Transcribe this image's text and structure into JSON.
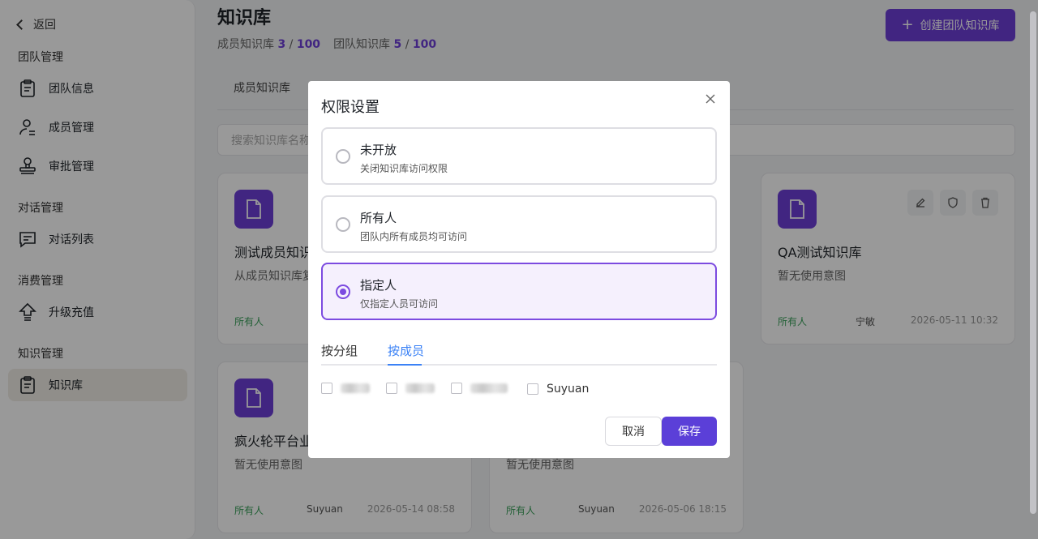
{
  "sidebar": {
    "back_label": "返回",
    "sections": [
      {
        "title": "团队管理",
        "items": [
          "团队信息",
          "成员管理",
          "审批管理"
        ]
      },
      {
        "title": "对话管理",
        "items": [
          "对话列表"
        ]
      },
      {
        "title": "消费管理",
        "items": [
          "升级充值"
        ]
      },
      {
        "title": "知识管理",
        "items": [
          "知识库"
        ]
      }
    ],
    "active_item": "知识库"
  },
  "header": {
    "title": "知识库",
    "member_quota_label": "成员知识库",
    "member_quota_used": "3",
    "member_quota_total": "100",
    "team_quota_label": "团队知识库",
    "team_quota_used": "5",
    "team_quota_total": "100",
    "separator": "/",
    "create_button_label": "创建团队知识库"
  },
  "tabs": {
    "member_tab": "成员知识库"
  },
  "search": {
    "placeholder": "搜索知识库名称"
  },
  "cards": [
    {
      "title": "测试成员知识库",
      "description": "从成员知识库复制",
      "permission": "所有人",
      "owner": "",
      "date": ""
    },
    {
      "title": "QA测试知识库",
      "description": "暂无使用意图",
      "permission": "所有人",
      "owner": "宁敏",
      "date": "2026-05-11 10:32"
    },
    {
      "title": "疯火轮平台业",
      "description": "暂无使用意图",
      "permission": "所有人",
      "owner": "Suyuan",
      "date": "2026-05-14 08:58"
    },
    {
      "title": "",
      "description": "暂无使用意图",
      "permission": "所有人",
      "owner": "Suyuan",
      "date": "2026-05-06 18:15"
    }
  ],
  "modal": {
    "title": "权限设置",
    "options": [
      {
        "title": "未开放",
        "description": "关闭知识库访问权限",
        "selected": false
      },
      {
        "title": "所有人",
        "description": "团队内所有成员均可访问",
        "selected": false
      },
      {
        "title": "指定人",
        "description": "仅指定人员可访问",
        "selected": true
      }
    ],
    "sub_tabs": [
      "按分组",
      "按成员"
    ],
    "active_sub_tab": "按成员",
    "members": [
      "",
      "",
      "",
      "Suyuan"
    ],
    "cancel_label": "取消",
    "save_label": "保存"
  },
  "colors": {
    "accent": "#6d3fd8",
    "save_button": "#5b3fd8",
    "link_blue": "#3b82f6",
    "permission_green": "#3aa05a"
  }
}
